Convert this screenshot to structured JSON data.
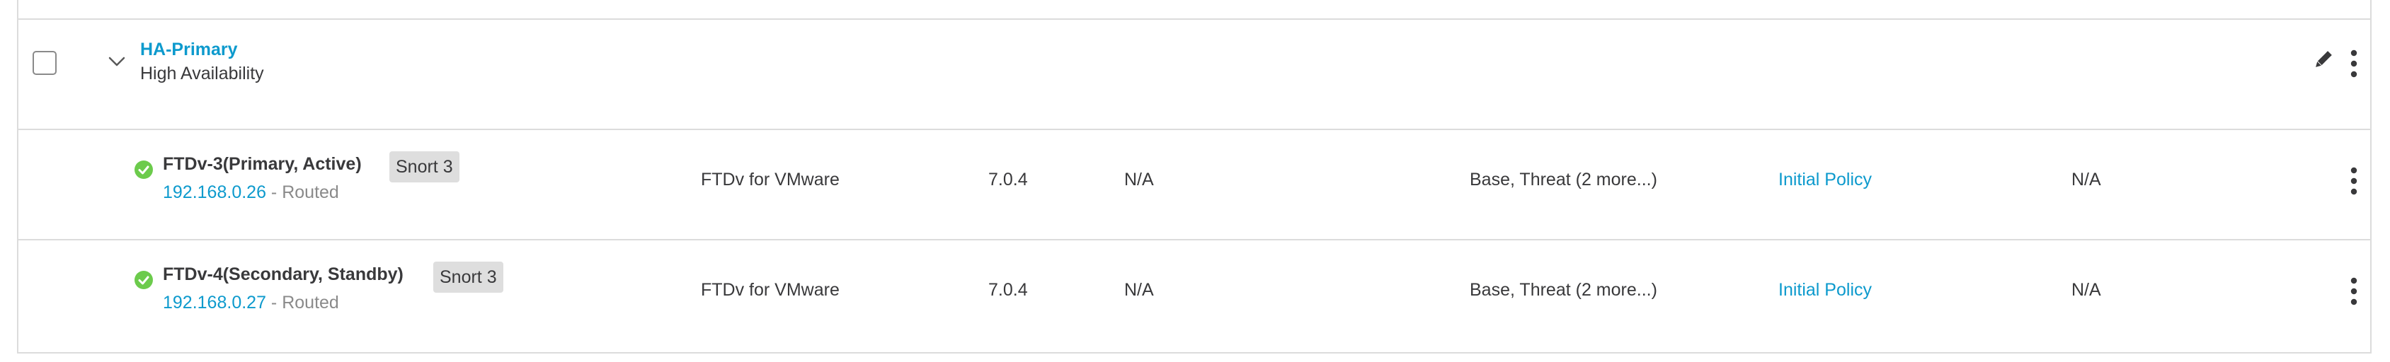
{
  "group": {
    "name": "HA-Primary",
    "type": "High Availability",
    "selected": false,
    "expanded": true,
    "icons": [
      "chevron-down-icon",
      "pencil-icon",
      "kebab-menu-icon"
    ]
  },
  "devices": [
    {
      "name": "FTDv-3(Primary, Active)",
      "badge": "Snort 3",
      "ip": "192.168.0.26",
      "mode": " - Routed",
      "model": "FTDv for VMware",
      "version": "7.0.4",
      "chassis": "N/A",
      "licenses": "Base, Threat (2 more...)",
      "policy": "Initial Policy",
      "auto_rollback": "N/A",
      "status_icon": "check-circle-icon",
      "status_color": "#6ccb4c"
    },
    {
      "name": "FTDv-4(Secondary, Standby)",
      "badge": "Snort 3",
      "ip": "192.168.0.27",
      "mode": " - Routed",
      "model": "FTDv for VMware",
      "version": "7.0.4",
      "chassis": "N/A",
      "licenses": "Base, Threat (2 more...)",
      "policy": "Initial Policy",
      "auto_rollback": "N/A",
      "status_icon": "check-circle-icon",
      "status_color": "#6ccb4c"
    }
  ],
  "colors": {
    "link": "#0d9acd",
    "text": "#39393b",
    "muted": "#8a8a8a",
    "border": "#dcdcdc",
    "badge_bg": "#dedede"
  }
}
